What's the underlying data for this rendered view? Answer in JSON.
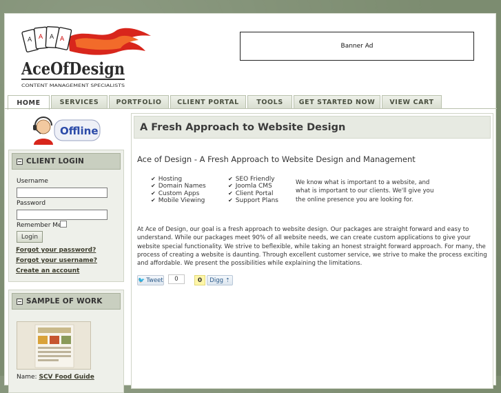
{
  "header": {
    "logo_text": "AceOfDesign",
    "logo_tagline": "CONTENT MANAGEMENT SPECIALISTS",
    "banner_text": "Banner Ad"
  },
  "nav": {
    "tabs": [
      {
        "label": "HOME"
      },
      {
        "label": "SERVICES"
      },
      {
        "label": "PORTFOLIO"
      },
      {
        "label": "CLIENT PORTAL"
      },
      {
        "label": "TOOLS"
      },
      {
        "label": "GET STARTED NOW"
      },
      {
        "label": "VIEW CART"
      }
    ],
    "active": "HOME"
  },
  "sidebar": {
    "status_text": "Offline",
    "client_login": {
      "title": "CLIENT LOGIN",
      "username_label": "Username",
      "username_value": "",
      "password_label": "Password",
      "password_value": "",
      "remember_label": "Remember Me",
      "login_button": "Login",
      "forgot_password": "Forgot your password?",
      "forgot_username": "Forgot your username?",
      "create_account": "Create an account"
    },
    "sample": {
      "title": "SAMPLE OF WORK",
      "name_label": "Name:",
      "name_link": "SCV Food Guide"
    }
  },
  "main": {
    "title": "A Fresh Approach to Website Design",
    "subtitle": "Ace of Design - A Fresh Approach to Website Design and Management",
    "features_col1": [
      "Hosting",
      "Domain Names",
      "Custom Apps",
      "Mobile Viewing"
    ],
    "features_col2": [
      "SEO Friendly",
      "Joomla CMS",
      "Client Portal",
      "Support Plans"
    ],
    "blurb": "We know what is important to a website, and what is important to our clients.  We'll give you the online presence you are looking for.",
    "paragraph": "At Ace of Design, our goal is a fresh approach to website design.  Our packages are straight forward and easy to understand. While our packages meet 90% of all website needs, we can create custom applications to give your website special functionality. We strive to beflexible, while taking an honest straight forward approach.  For many, the process of creating a website is daunting. Through excellent customer service, we strive to make the process exciting and affordable.  We present the possibilities while explaining the limitations.",
    "social": {
      "tweet_label": "Tweet",
      "tweet_count": "0",
      "digg_count": "0",
      "digg_label": "Digg"
    }
  },
  "colors": {
    "background": "#7c8c70",
    "nav_tab": "#d8ddd0",
    "box_header": "#c9cfc0",
    "title_bar": "#e7eae2",
    "flame_red": "#d8261c"
  }
}
